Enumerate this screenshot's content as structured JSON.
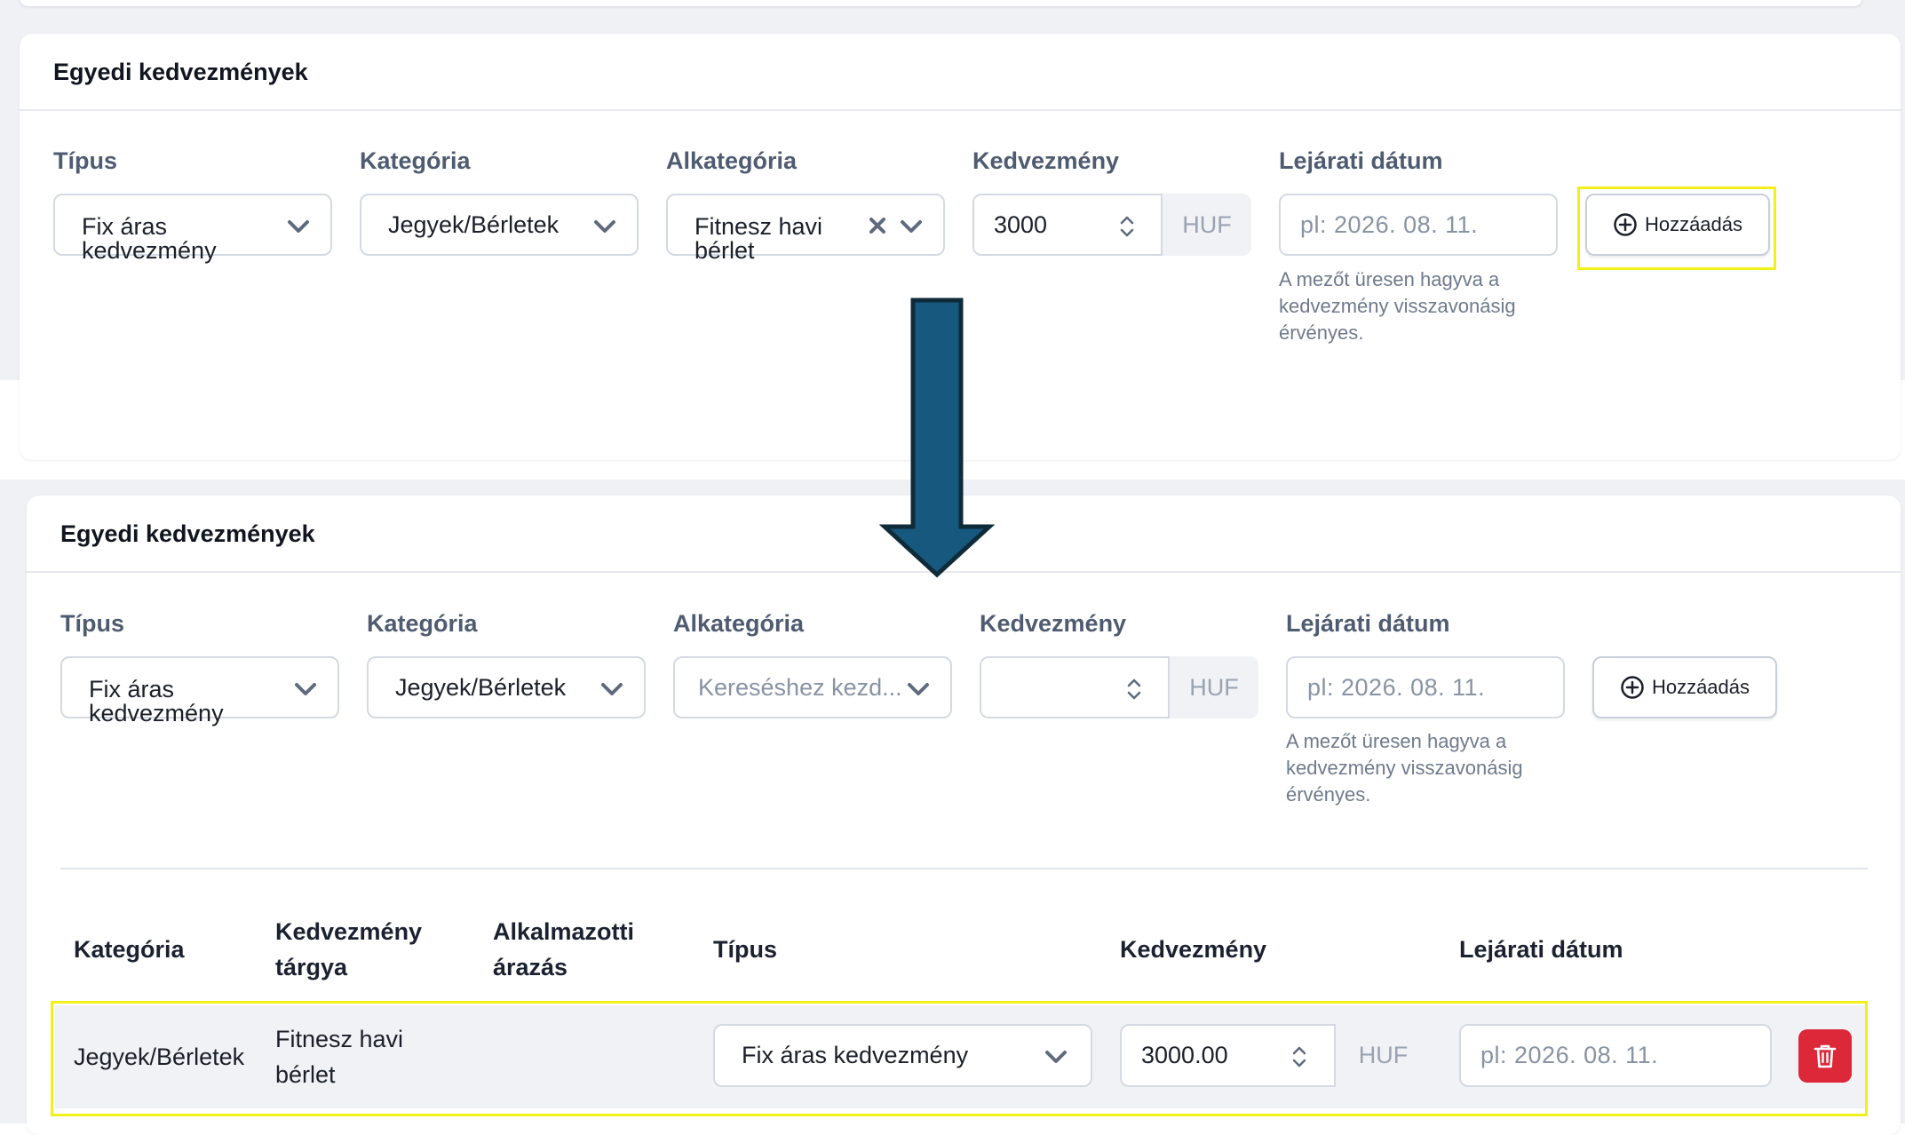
{
  "colors": {
    "arrow_fill": "#17587e",
    "highlight": "#f2f01a",
    "delete_button": "#dc2838"
  },
  "before": {
    "section_title": "Egyedi kedvezmények",
    "labels": {
      "type": "Típus",
      "category": "Kategória",
      "subcategory": "Alkategória",
      "discount": "Kedvezmény",
      "expiry": "Lejárati dátum"
    },
    "type_value": [
      "Fix áras",
      "kedvezmény"
    ],
    "category_value": "Jegyek/Bérletek",
    "subcategory_value": [
      "Fitnesz havi",
      "bérlet"
    ],
    "discount_value": "3000",
    "currency": "HUF",
    "expiry_placeholder": "pl: 2026. 08. 11.",
    "expiry_hint": "A mezőt üresen hagyva a kedvezmény visszavonásig érvényes.",
    "add_button": "Hozzáadás"
  },
  "after": {
    "section_title": "Egyedi kedvezmények",
    "labels": {
      "type": "Típus",
      "category": "Kategória",
      "subcategory": "Alkategória",
      "discount": "Kedvezmény",
      "expiry": "Lejárati dátum"
    },
    "type_value": [
      "Fix áras",
      "kedvezmény"
    ],
    "category_value": "Jegyek/Bérletek",
    "subcategory_placeholder": "Kereséshez kezd...",
    "discount_value": "",
    "currency": "HUF",
    "expiry_placeholder": "pl: 2026. 08. 11.",
    "expiry_hint": "A mezőt üresen hagyva a kedvezmény visszavonásig érvényes.",
    "add_button": "Hozzáadás",
    "table": {
      "headers": {
        "category": "Kategória",
        "subject": [
          "Kedvezmény",
          "tárgya"
        ],
        "employee_pricing": [
          "Alkalmazotti",
          "árazás"
        ],
        "type": "Típus",
        "discount": "Kedvezmény",
        "expiry": "Lejárati dátum"
      },
      "rows": [
        {
          "category": "Jegyek/Bérletek",
          "subject": [
            "Fitnesz havi",
            "bérlet"
          ],
          "employee_pricing": "",
          "type": "Fix áras kedvezmény",
          "discount": "3000.00",
          "currency": "HUF",
          "expiry_placeholder": "pl: 2026. 08. 11."
        }
      ]
    }
  }
}
